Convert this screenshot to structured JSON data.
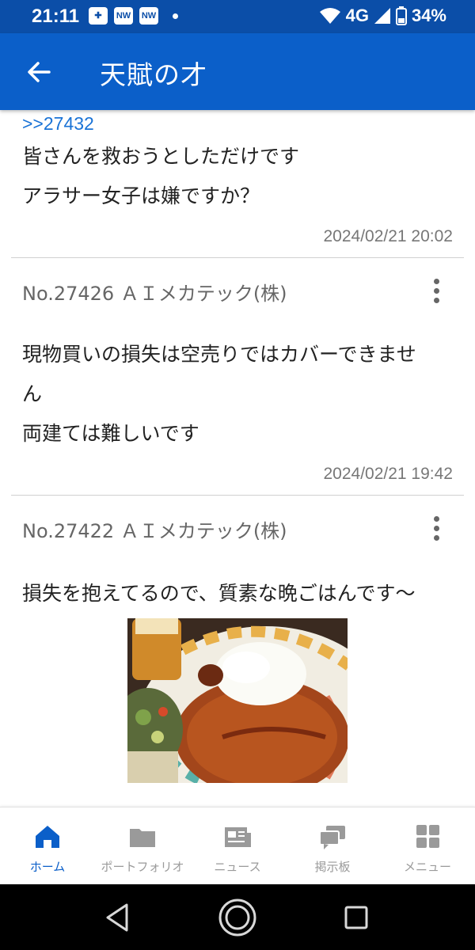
{
  "status_bar": {
    "time": "21:11",
    "network": "4G",
    "battery": "34%",
    "notification_icons": [
      "gear-badge-icon",
      "nw-icon",
      "nw-icon"
    ]
  },
  "app_bar": {
    "title": "天賦の才",
    "back_icon": "arrow-left-icon",
    "background": "#0b5fc9"
  },
  "posts": [
    {
      "reply_to": ">>27432",
      "lines": [
        "皆さんを救おうとしただけです",
        "アラサー女子は嫌ですか？"
      ],
      "date": "2024/02/21 20:02"
    },
    {
      "header": "No.27426 ＡＩメカテック(株)",
      "lines": [
        "現物買いの損失は空売りではカバーできませ",
        "ん",
        "両建ては難しいです"
      ],
      "date": "2024/02/21 19:42"
    },
    {
      "header": "No.27422 ＡＩメカテック(株)",
      "lines": [
        "損失を抱えてるので、質素な晩ごはんです〜"
      ],
      "image": "curry-rice-photo"
    }
  ],
  "bottom_nav": [
    {
      "label": "ホーム",
      "icon": "home-icon",
      "active": true
    },
    {
      "label": "ポートフォリオ",
      "icon": "folder-icon",
      "active": false
    },
    {
      "label": "ニュース",
      "icon": "newspaper-icon",
      "active": false
    },
    {
      "label": "掲示板",
      "icon": "chat-bubbles-icon",
      "active": false
    },
    {
      "label": "メニュー",
      "icon": "grid-icon",
      "active": false
    }
  ],
  "colors": {
    "accent": "#0b5fc9",
    "status_bar": "#0b4ea8",
    "link": "#1a73d6",
    "muted_text": "#777777",
    "inactive_nav": "#9a9a9a"
  }
}
